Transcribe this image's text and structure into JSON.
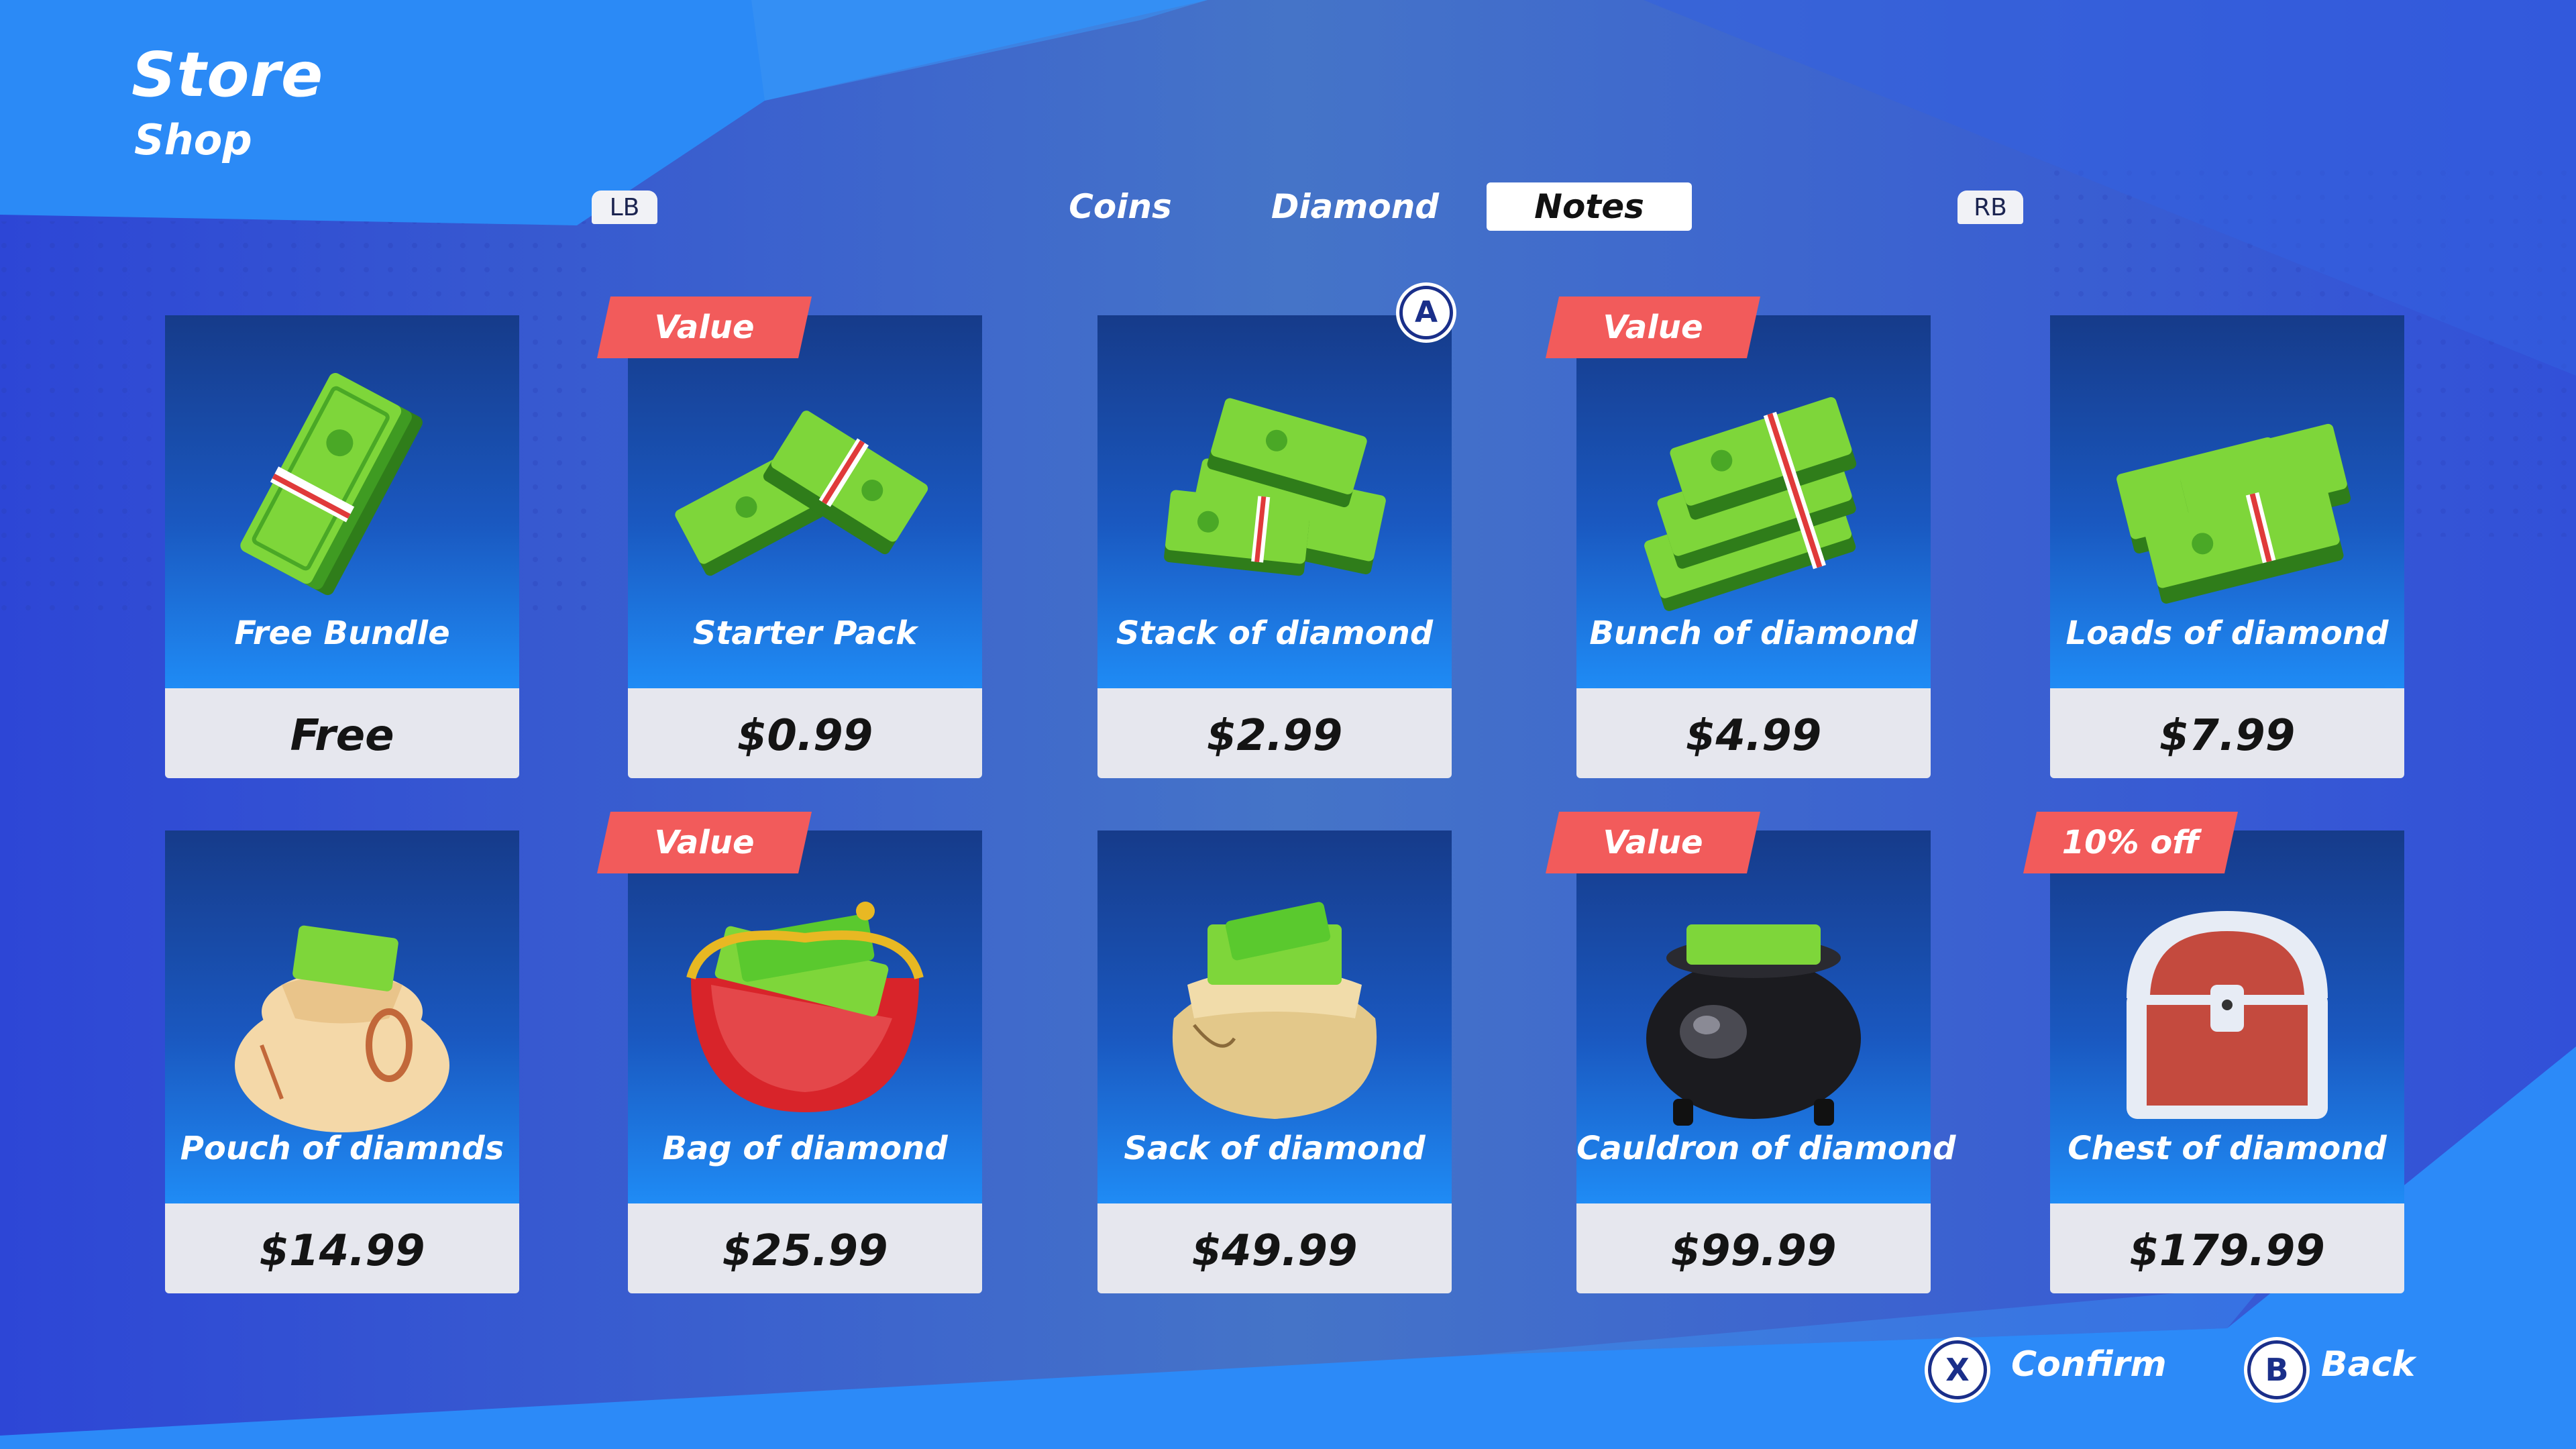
{
  "header": {
    "title": "Store",
    "subtitle": "Shop"
  },
  "shoulders": {
    "left": "LB",
    "right": "RB"
  },
  "tabs": [
    {
      "label": "Coins",
      "active": false
    },
    {
      "label": "Diamond",
      "active": false
    },
    {
      "label": "Notes",
      "active": true
    }
  ],
  "focus_hint": "A",
  "items": [
    {
      "name": "Free Bundle",
      "price": "Free",
      "badge": "",
      "art": "single-cash-stack"
    },
    {
      "name": "Starter Pack",
      "price": "$0.99",
      "badge": "Value",
      "art": "two-cash-stacks"
    },
    {
      "name": "Stack of diamond",
      "price": "$2.99",
      "badge": "",
      "art": "cash-stack-pile"
    },
    {
      "name": "Bunch of diamond",
      "price": "$4.99",
      "badge": "Value",
      "art": "tall-cash-stack"
    },
    {
      "name": "Loads of diamond",
      "price": "$7.99",
      "badge": "",
      "art": "many-cash-stacks"
    },
    {
      "name": "Pouch of diamnds",
      "price": "$14.99",
      "badge": "",
      "art": "money-pouch"
    },
    {
      "name": "Bag of diamond",
      "price": "$25.99",
      "badge": "Value",
      "art": "red-purse"
    },
    {
      "name": "Sack of diamond",
      "price": "$49.99",
      "badge": "",
      "art": "money-sack"
    },
    {
      "name": "Cauldron of diamond",
      "price": "$99.99",
      "badge": "Value",
      "art": "black-cauldron"
    },
    {
      "name": "Chest of diamond",
      "price": "$179.99",
      "badge": "10% off",
      "art": "treasure-chest"
    }
  ],
  "footer": {
    "confirm_key": "X",
    "confirm_label": "Confirm",
    "back_key": "B",
    "back_label": "Back"
  },
  "colors": {
    "ribbon": "#f25b5b",
    "cash": "#5ac92e",
    "card_top": "#163b8a",
    "card_bottom": "#e6e7ee"
  }
}
